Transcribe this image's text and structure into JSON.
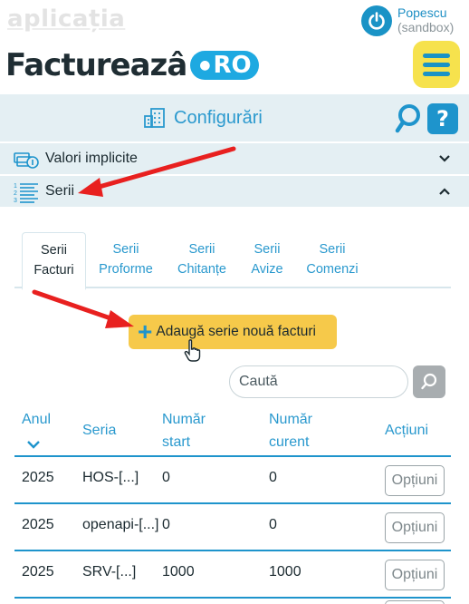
{
  "header": {
    "app_label": "aplicația",
    "logo_main": "Factureazâ",
    "logo_badge": "RO",
    "user_name": "Popescu",
    "user_env": "(sandbox)"
  },
  "config_bar": {
    "title": "Configurări",
    "help_label": "?"
  },
  "accordion": {
    "items": [
      {
        "label": "Valori implicite",
        "expanded": false,
        "icon": "money-coins-icon"
      },
      {
        "label": "Serii",
        "expanded": true,
        "icon": "numbered-list-icon"
      }
    ]
  },
  "tabs": [
    {
      "line1": "Serii",
      "line2": "Facturi",
      "active": true
    },
    {
      "line1": "Serii",
      "line2": "Proforme",
      "active": false
    },
    {
      "line1": "Serii",
      "line2": "Chitanțe",
      "active": false
    },
    {
      "line1": "Serii",
      "line2": "Avize",
      "active": false
    },
    {
      "line1": "Serii",
      "line2": "Comenzi",
      "active": false
    }
  ],
  "add_button": {
    "label": "Adaugă serie nouă facturi"
  },
  "search": {
    "placeholder": "Caută"
  },
  "table": {
    "headers": {
      "year": "Anul",
      "series": "Seria",
      "start_l1": "Număr",
      "start_l2": "start",
      "current_l1": "Număr",
      "current_l2": "curent",
      "actions": "Acțiuni"
    },
    "rows": [
      {
        "year": "2025",
        "series": "HOS-[...]",
        "start": "0",
        "current": "0",
        "action": "Opțiuni"
      },
      {
        "year": "2025",
        "series": "openapi-[...]",
        "start": "0",
        "current": "0",
        "action": "Opțiuni"
      },
      {
        "year": "2025",
        "series": "SRV-[...]",
        "start": "1000",
        "current": "1000",
        "action": "Opțiuni"
      }
    ]
  },
  "colors": {
    "brand_blue": "#1e94cc",
    "accent_yellow": "#f6c94a",
    "menu_yellow": "#f6e24d",
    "annotation_red": "#e8201f",
    "panel_bg": "#e4eff3"
  }
}
